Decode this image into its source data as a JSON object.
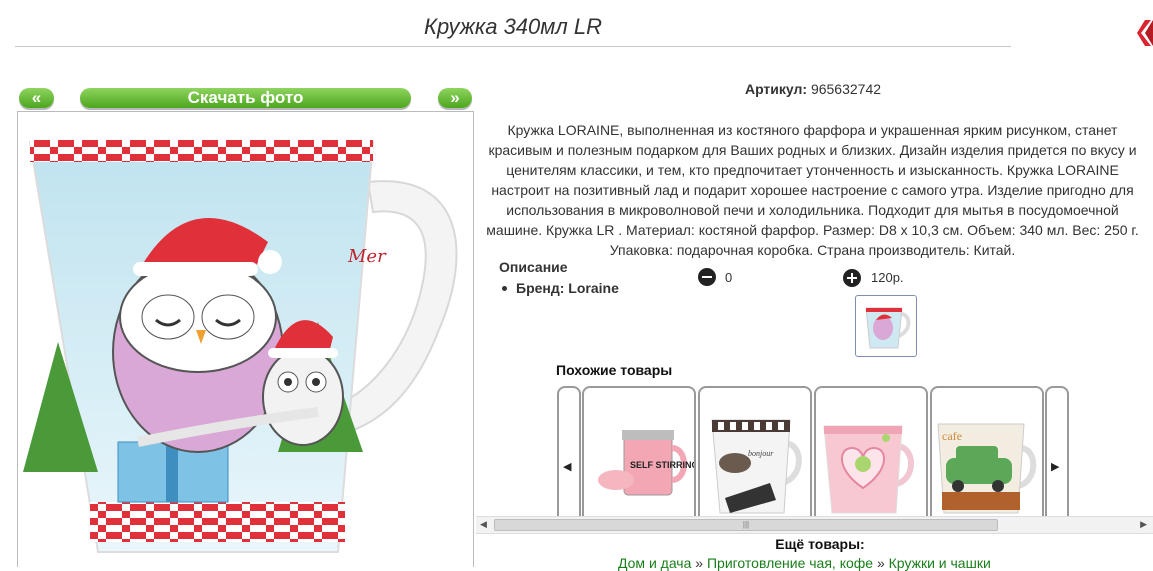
{
  "page": {
    "title": "Кружка 340мл LR"
  },
  "photo_nav": {
    "prev_label": "«",
    "download_label": "Скачать фото",
    "next_label": "»"
  },
  "product": {
    "article_label": "Артикул:",
    "article_value": "965632742",
    "description": "Кружка LORAINE, выполненная из костяного фарфора и украшенная ярким рисунком, станет красивым и полезным подарком для Ваших родных и близких. Дизайн изделия придется по вкусу и ценителям классики, и тем, кто предпочитает утонченность и изысканность. Кружка LORAINE настроит на позитивный лад и подарит хорошее настроение с самого утра. Изделие пригодно для использования в микроволновой печи и холодильника. Подходит для мытья в посудомоечной машине. Кружка LR . Материал: костяной фарфор. Размер: D8 x 10,3 см. Объем: 340 мл. Вес: 250 г. Упаковка: подарочная коробка. Страна производитель: Китай.",
    "spec_heading": "Описание",
    "spec_brand": "Бренд: Loraine",
    "quantity": "0",
    "price": "120р."
  },
  "similar": {
    "title": "Похожие товары",
    "left_arrow": "◀",
    "right_arrow": "▶",
    "items": [
      {
        "label": "SELF STIRRING MUG"
      },
      {
        "label": "bonjour"
      },
      {
        "label": ""
      },
      {
        "label": "cafe"
      }
    ]
  },
  "more": {
    "title": "Ещё товары:",
    "crumb1": "Дом и дача",
    "sep1": " » ",
    "crumb2": "Приготовление чая, кофе",
    "sep2": " » ",
    "crumb3": "Кружки и чашки"
  },
  "colors": {
    "green_button": "#5cb82e",
    "link": "#1a7f1a",
    "red_checker": "#e0303a"
  }
}
